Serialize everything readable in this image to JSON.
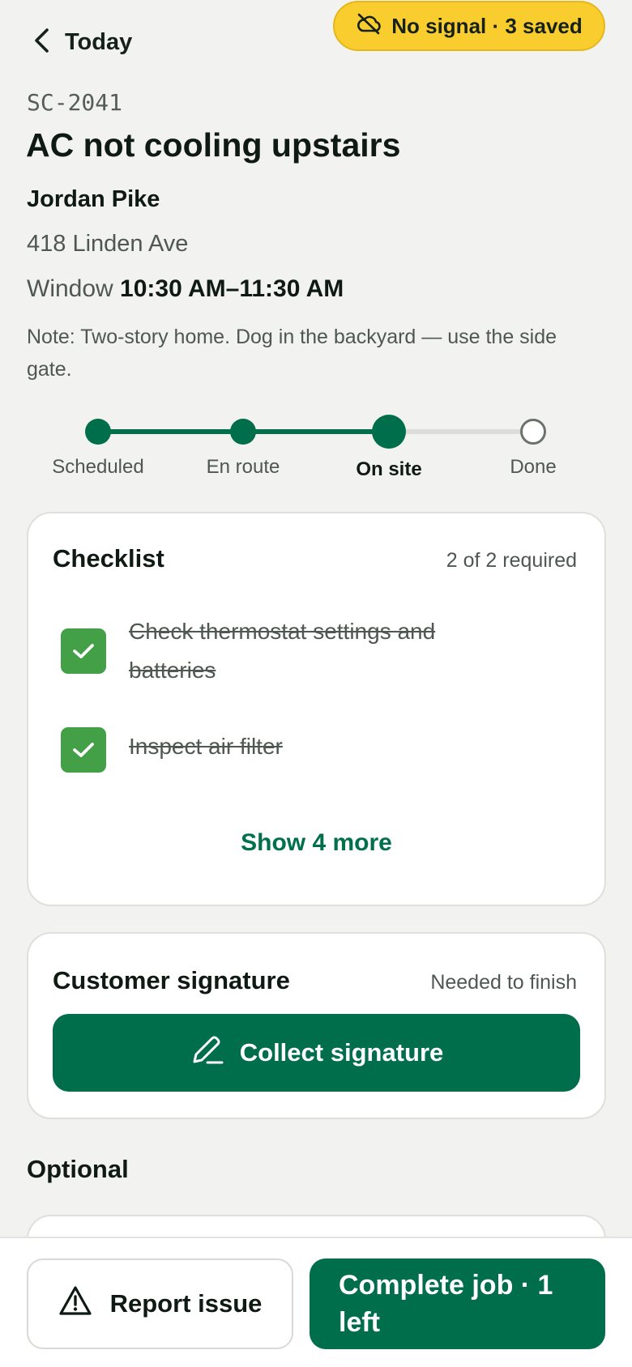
{
  "header": {
    "back_label": "Today",
    "signal_badge": "No signal · 3 saved"
  },
  "job": {
    "id": "SC-2041",
    "title": "AC not cooling upstairs",
    "customer": "Jordan Pike",
    "address": "418 Linden Ave",
    "window_label": "Window",
    "window_value": "10:30 AM–11:30 AM",
    "note": "Note: Two-story home. Dog in the backyard — use the side gate."
  },
  "progress": {
    "steps": [
      {
        "label": "Scheduled",
        "state": "complete"
      },
      {
        "label": "En route",
        "state": "complete"
      },
      {
        "label": "On site",
        "state": "current"
      },
      {
        "label": "Done",
        "state": "pending"
      }
    ]
  },
  "checklist": {
    "title": "Checklist",
    "meta": "2 of 2 required",
    "items": [
      {
        "label": "Check thermostat settings and batteries",
        "checked": true
      },
      {
        "label": "Inspect air filter",
        "checked": true
      }
    ],
    "show_more": "Show 4 more"
  },
  "signature": {
    "title": "Customer signature",
    "meta": "Needed to finish",
    "button": "Collect signature"
  },
  "optional": {
    "label": "Optional"
  },
  "actions": {
    "report": "Report issue",
    "complete": "Complete job · 1 left"
  },
  "colors": {
    "brand_green": "#006e4a",
    "check_green": "#43a047",
    "warning_yellow": "#f9cd2e",
    "background": "#f2f2f0"
  }
}
